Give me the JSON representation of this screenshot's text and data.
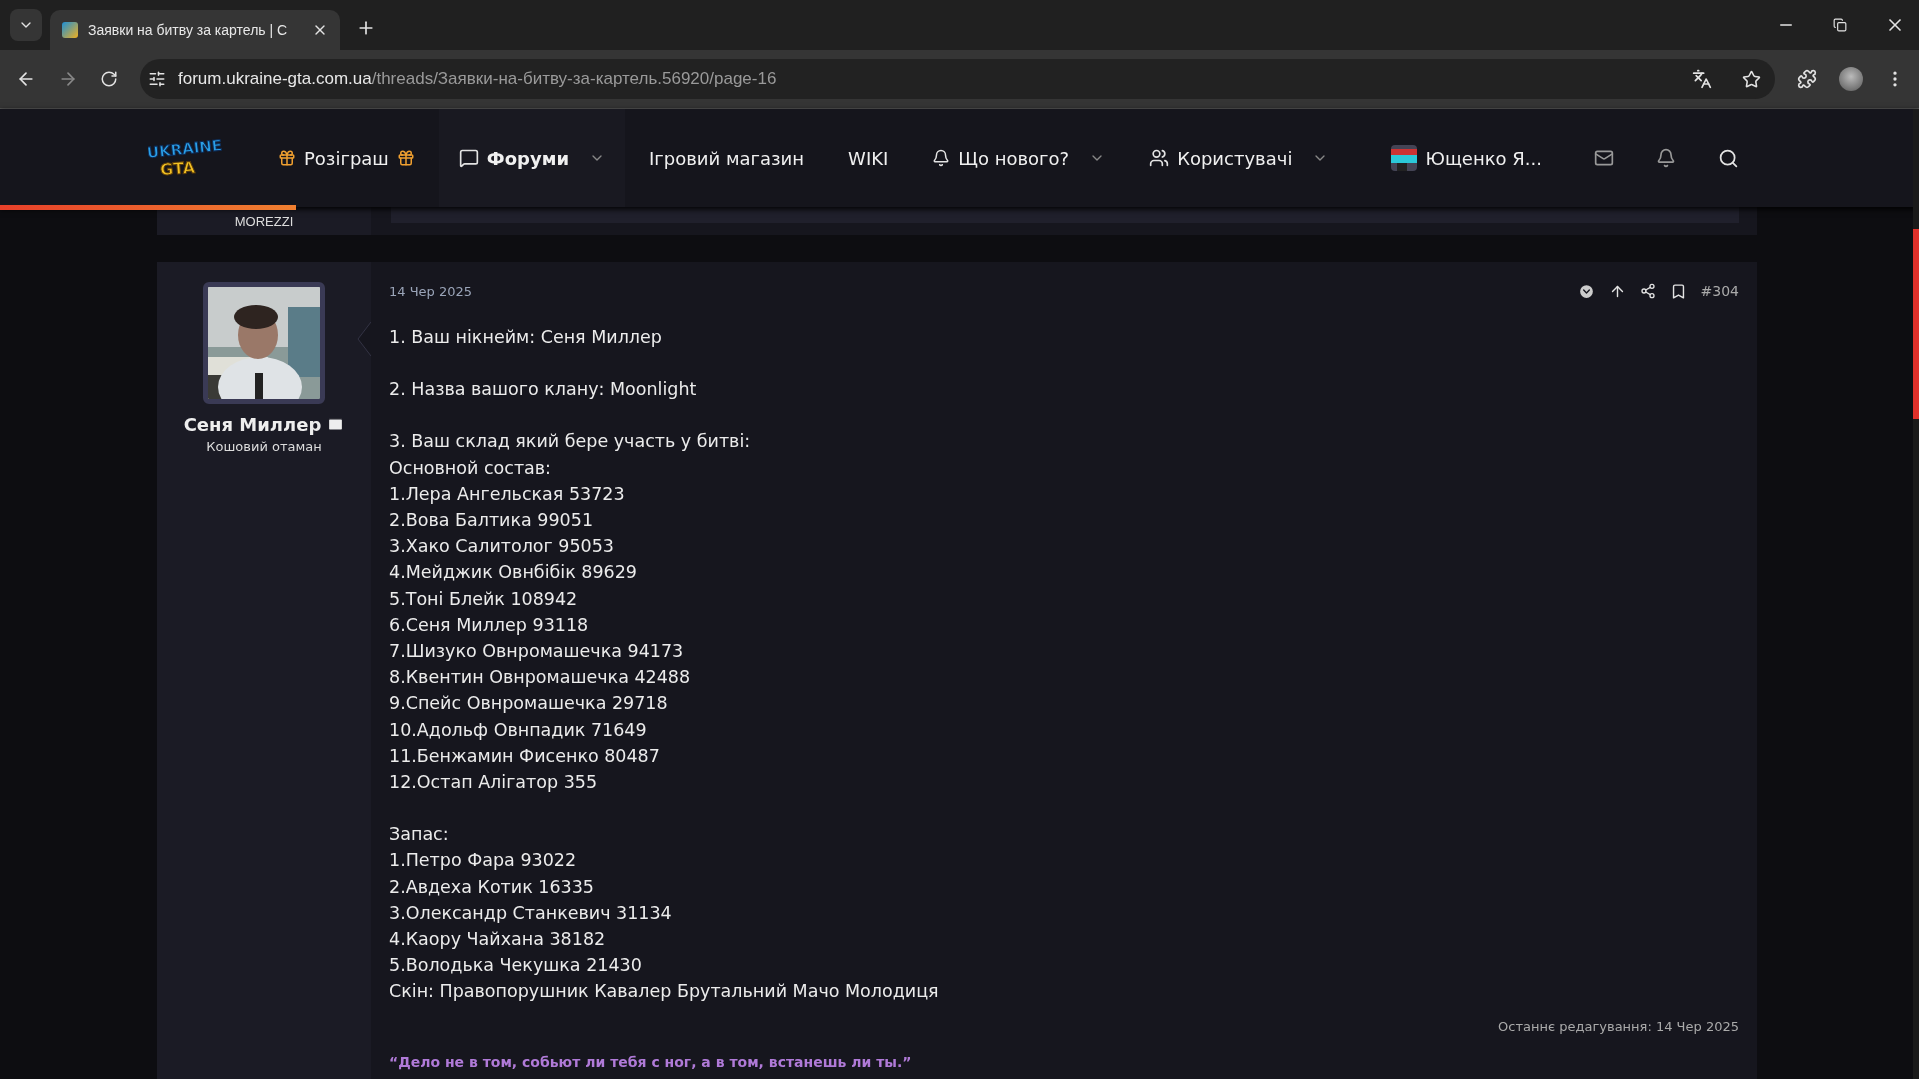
{
  "browser": {
    "tab_title": "Заявки на битву за картель | С",
    "url_host": "forum.ukraine-gta.com.ua",
    "url_path": "/threads/Заявки-на-битву-за-картель.56920/page-16"
  },
  "logo": {
    "line1": "UKRAINE",
    "line2": "GTA"
  },
  "nav": {
    "items": [
      {
        "label": "Розіграш",
        "kind": "gift",
        "selected": false,
        "dropdown": false
      },
      {
        "label": "Форуми",
        "kind": "forum",
        "selected": true,
        "dropdown": true
      },
      {
        "label": "Ігровий магазин",
        "kind": "plain",
        "selected": false,
        "dropdown": false
      },
      {
        "label": "WIKI",
        "kind": "plain",
        "selected": false,
        "dropdown": false
      },
      {
        "label": "Що нового?",
        "kind": "news",
        "selected": false,
        "dropdown": true
      },
      {
        "label": "Користувачі",
        "kind": "users",
        "selected": false,
        "dropdown": true
      }
    ]
  },
  "account": {
    "name": "Ющенко Я..."
  },
  "reading_progress": {
    "level": 0.154
  },
  "previous_post": {
    "author": "MOREZZI"
  },
  "post": {
    "date": "14 Чер 2025",
    "number": "#304",
    "author": {
      "name": "Сеня Миллер",
      "title": "Кошовий отаман"
    },
    "blocks": [
      [
        "1. Ваш нікнейм: Сеня Миллер"
      ],
      [
        "2. Назва вашого клану: Moonlight"
      ],
      [
        "3. Ваш склад який бере участь у битві:",
        "Основной состав:",
        "1.Лера Ангельская 53723",
        "2.Вова Балтика 99051",
        "3.Хако Салитолог 95053",
        "4.Мейджик Овнбібік 89629",
        "5.Тоні Блейк 108942",
        "6.Сеня Миллер 93118",
        "7.Шизуко Овнромашечка 94173",
        "8.Квентин Овнромашечка 42488",
        "9.Спейс Овнромашечка 29718",
        "10.Адольф Овнпадик 71649",
        "11.Бенжамин Фисенко 80487",
        "12.Остап Алігатор 355"
      ],
      [
        "Запас:",
        "1.Петро Фара 93022",
        "2.Авдеха Котик 16335",
        "3.Олександр Станкевич 31134",
        "4.Каору Чайхана 38182",
        "5.Володька Чекушка 21430",
        "Скін: Правопорушник Кавалер Брутальний Мачо Молодиця"
      ]
    ],
    "edited": "Останнє редагування: 14 Чер 2025",
    "signature": "“Дело не в том, собьют ли тебя с ног, а в том, встанешь ли ты.”"
  }
}
